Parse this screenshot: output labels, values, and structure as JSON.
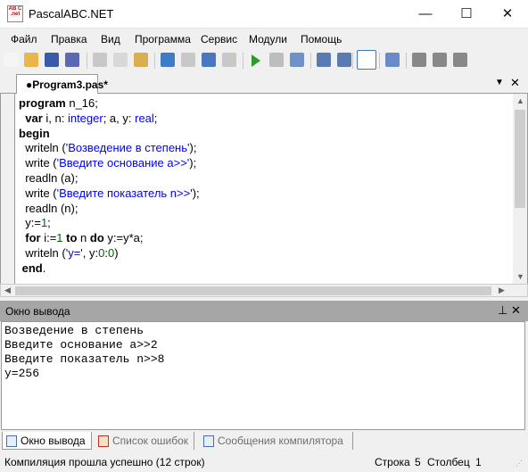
{
  "window": {
    "title": "PascalABC.NET",
    "icon_text": "AB C .net",
    "controls": [
      "—",
      "☐",
      "✕"
    ]
  },
  "menu": [
    "Файл",
    "Правка",
    "Вид",
    "Программа",
    "Сервис",
    "Модули",
    "Помощь"
  ],
  "toolbar": [
    {
      "icon": "new-file-icon",
      "color": "#f5f5f5"
    },
    {
      "icon": "open-folder-icon",
      "color": "#e8b64a"
    },
    {
      "icon": "save-icon",
      "color": "#3a5ca8"
    },
    {
      "icon": "save-all-icon",
      "color": "#5a6ab0"
    },
    {
      "icon": "cut-icon",
      "color": "#c8c8c8"
    },
    {
      "icon": "copy-icon",
      "color": "#d8d8d8"
    },
    {
      "icon": "paste-icon",
      "color": "#d9b050"
    },
    {
      "icon": "undo-icon",
      "color": "#3c7cc8"
    },
    {
      "icon": "redo-icon",
      "color": "#c8c8c8"
    },
    {
      "icon": "navigate-back-icon",
      "color": "#4a78c0"
    },
    {
      "icon": "navigate-forward-icon",
      "color": "#c8c8c8"
    },
    {
      "icon": "run-icon",
      "color": "#2e9a2e"
    },
    {
      "icon": "stop-icon",
      "color": "#bdbdbd"
    },
    {
      "icon": "compile-icon",
      "color": "#7090c8"
    },
    {
      "icon": "indent-icon",
      "color": "#5a7ab0"
    },
    {
      "icon": "unindent-icon",
      "color": "#5a7ab0"
    },
    {
      "icon": "console-icon",
      "color": "#3d6db5"
    },
    {
      "icon": "document-icon",
      "color": "#6a8ac8"
    },
    {
      "icon": "debug-d-icon",
      "color": "#888888"
    },
    {
      "icon": "debug-l-icon",
      "color": "#888888"
    },
    {
      "icon": "debug-r-icon",
      "color": "#888888"
    }
  ],
  "editor": {
    "tab_label": "●Program3.pas*",
    "lines": [
      [
        [
          "program",
          "kw"
        ],
        [
          " n_16;",
          ""
        ]
      ],
      [
        [
          "  ",
          ""
        ],
        [
          "var",
          "kw"
        ],
        [
          " i, n: ",
          ""
        ],
        [
          "integer",
          "ty"
        ],
        [
          "; a, y: ",
          ""
        ],
        [
          "real",
          "ty"
        ],
        [
          ";",
          ""
        ]
      ],
      [
        [
          "begin",
          "kw"
        ]
      ],
      [
        [
          "  writeln (",
          ""
        ],
        [
          "'Возведение в степень'",
          "st"
        ],
        [
          ");",
          ""
        ]
      ],
      [
        [
          "  write (",
          ""
        ],
        [
          "'Введите основание a>>'",
          "st"
        ],
        [
          ");",
          ""
        ]
      ],
      [
        [
          "  readln (a);",
          ""
        ]
      ],
      [
        [
          "  write (",
          ""
        ],
        [
          "'Введите показатель n>>'",
          "st"
        ],
        [
          ");",
          ""
        ]
      ],
      [
        [
          "  readln (n);",
          ""
        ]
      ],
      [
        [
          "  y:=",
          ""
        ],
        [
          "1",
          "nm"
        ],
        [
          ";",
          ""
        ]
      ],
      [
        [
          "  ",
          ""
        ],
        [
          "for",
          "kw"
        ],
        [
          " i:=",
          ""
        ],
        [
          "1",
          "nm"
        ],
        [
          " ",
          ""
        ],
        [
          "to",
          "kw"
        ],
        [
          " n ",
          ""
        ],
        [
          "do",
          "kw"
        ],
        [
          " y:=y*a;",
          ""
        ]
      ],
      [
        [
          "  writeln (",
          ""
        ],
        [
          "'y='",
          "st"
        ],
        [
          ", y:",
          ""
        ],
        [
          "0",
          "nm"
        ],
        [
          ":",
          ""
        ],
        [
          "0",
          "nm"
        ],
        [
          ")",
          ""
        ]
      ],
      [
        [
          " ",
          ""
        ],
        [
          "end",
          "kw"
        ],
        [
          ".",
          ""
        ]
      ]
    ]
  },
  "output_panel": {
    "title": "Окно вывода",
    "lines": [
      "Возведение в степень",
      "Введите основание a>>2",
      "Введите показатель n>>8",
      "y=256"
    ]
  },
  "bottom_tabs": [
    "Окно вывода",
    "Список ошибок",
    "Сообщения компилятора"
  ],
  "status": {
    "message": "Компиляция прошла успешно (12 строк)",
    "line_label": "Строка",
    "line": "5",
    "col_label": "Столбец",
    "col": "1"
  }
}
